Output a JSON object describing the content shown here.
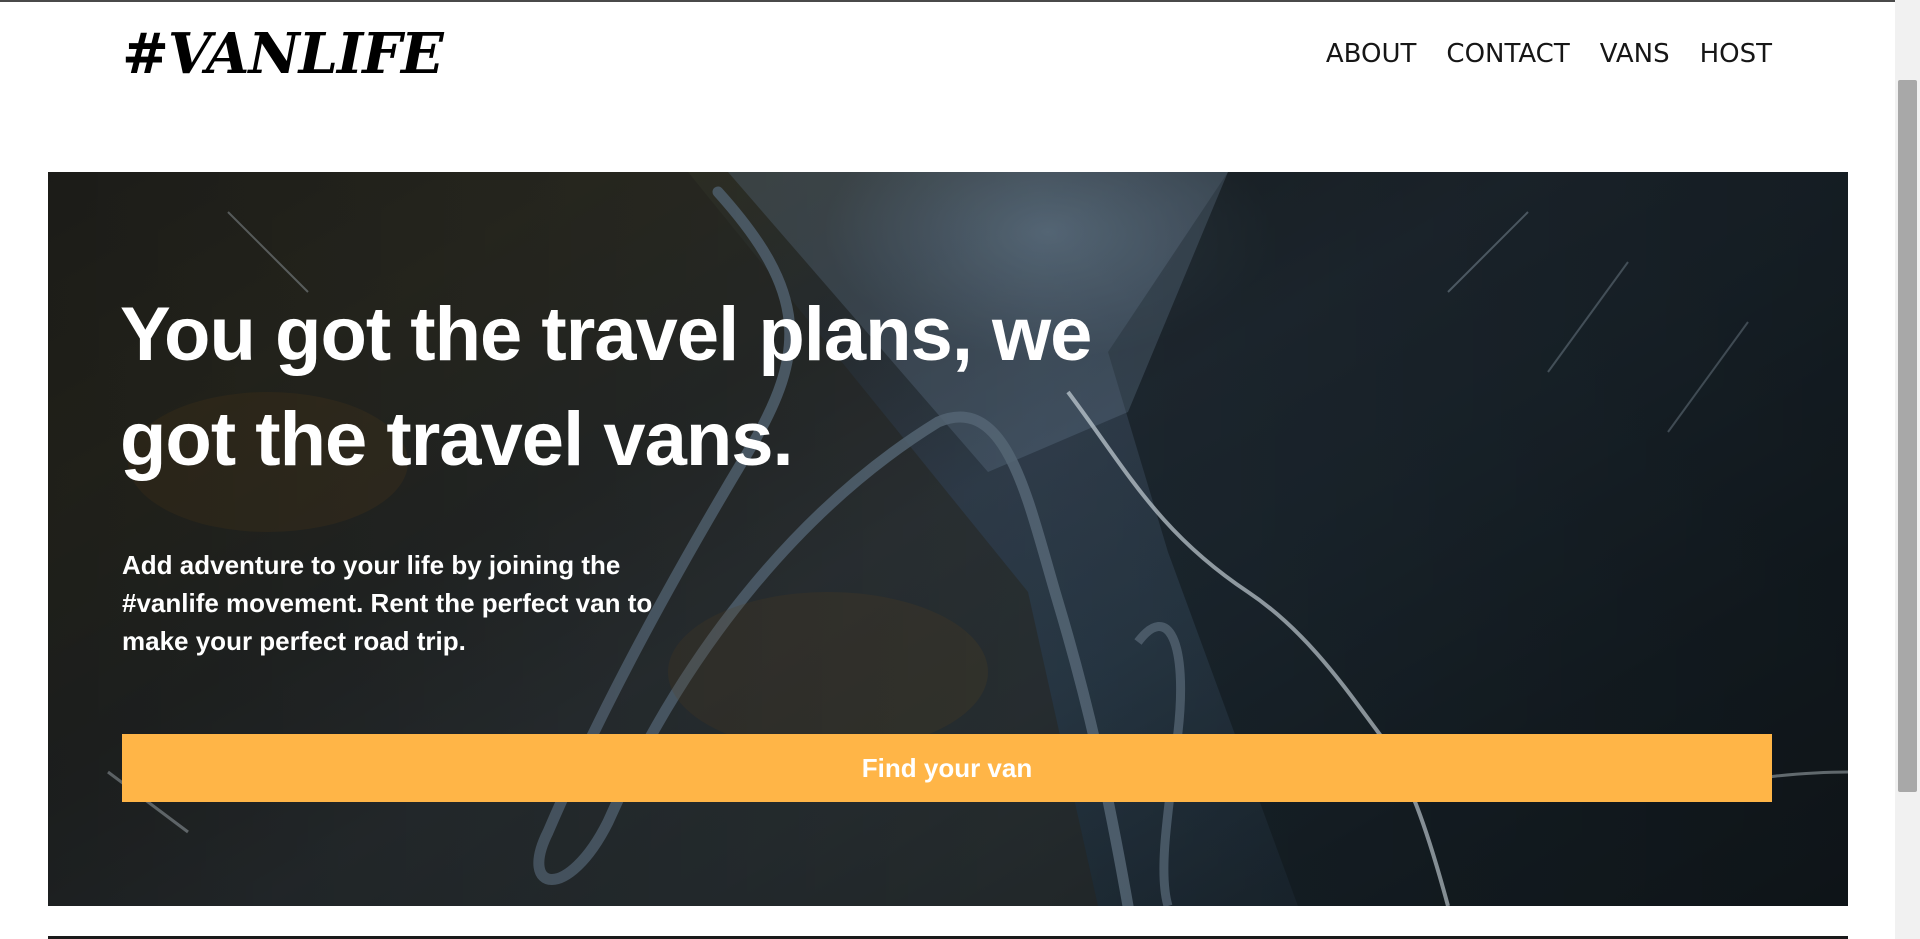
{
  "header": {
    "logo": "#VANLIFE",
    "nav": [
      {
        "label": "ABOUT"
      },
      {
        "label": "CONTACT"
      },
      {
        "label": "VANS"
      },
      {
        "label": "HOST"
      }
    ]
  },
  "hero": {
    "title": "You got the travel plans, we got the travel vans.",
    "text": "Add adventure to your life by joining the #vanlife movement. Rent the perfect van to make your perfect road trip.",
    "cta_label": "Find your van"
  },
  "colors": {
    "cta_background": "#ffb547",
    "text_dark": "#161616",
    "hero_text": "#ffffff"
  }
}
